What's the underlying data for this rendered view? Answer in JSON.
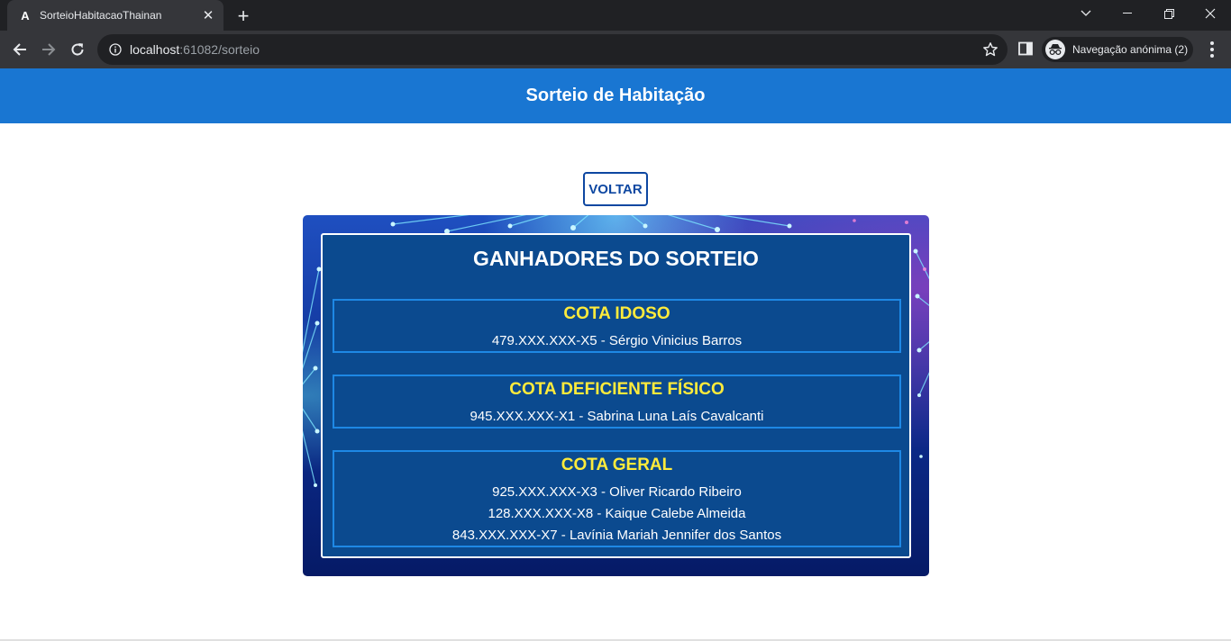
{
  "browser": {
    "tab_title": "SorteioHabitacaoThainan",
    "url_host": "localhost",
    "url_rest": ":61082/sorteio",
    "incognito_label": "Navegação anónima (2)"
  },
  "header": {
    "title": "Sorteio de Habitação"
  },
  "back_button": {
    "label": "VOLTAR"
  },
  "results": {
    "title": "GANHADORES DO SORTEIO",
    "cotas": [
      {
        "title": "COTA IDOSO",
        "winners": [
          "479.XXX.XXX-X5 - Sérgio Vinicius Barros"
        ]
      },
      {
        "title": "COTA DEFICIENTE FÍSICO",
        "winners": [
          "945.XXX.XXX-X1 - Sabrina Luna Laís Cavalcanti"
        ]
      },
      {
        "title": "COTA GERAL",
        "winners": [
          "925.XXX.XXX-X3 - Oliver Ricardo Ribeiro",
          "128.XXX.XXX-X8 - Kaique Calebe Almeida",
          "843.XXX.XXX-X7 - Lavínia Mariah Jennifer dos Santos"
        ]
      }
    ]
  },
  "colors": {
    "header_bg": "#1976d2",
    "cota_title": "#ffeb3b",
    "panel_bg": "#0b4a8f",
    "button_border": "#0d47a1"
  }
}
